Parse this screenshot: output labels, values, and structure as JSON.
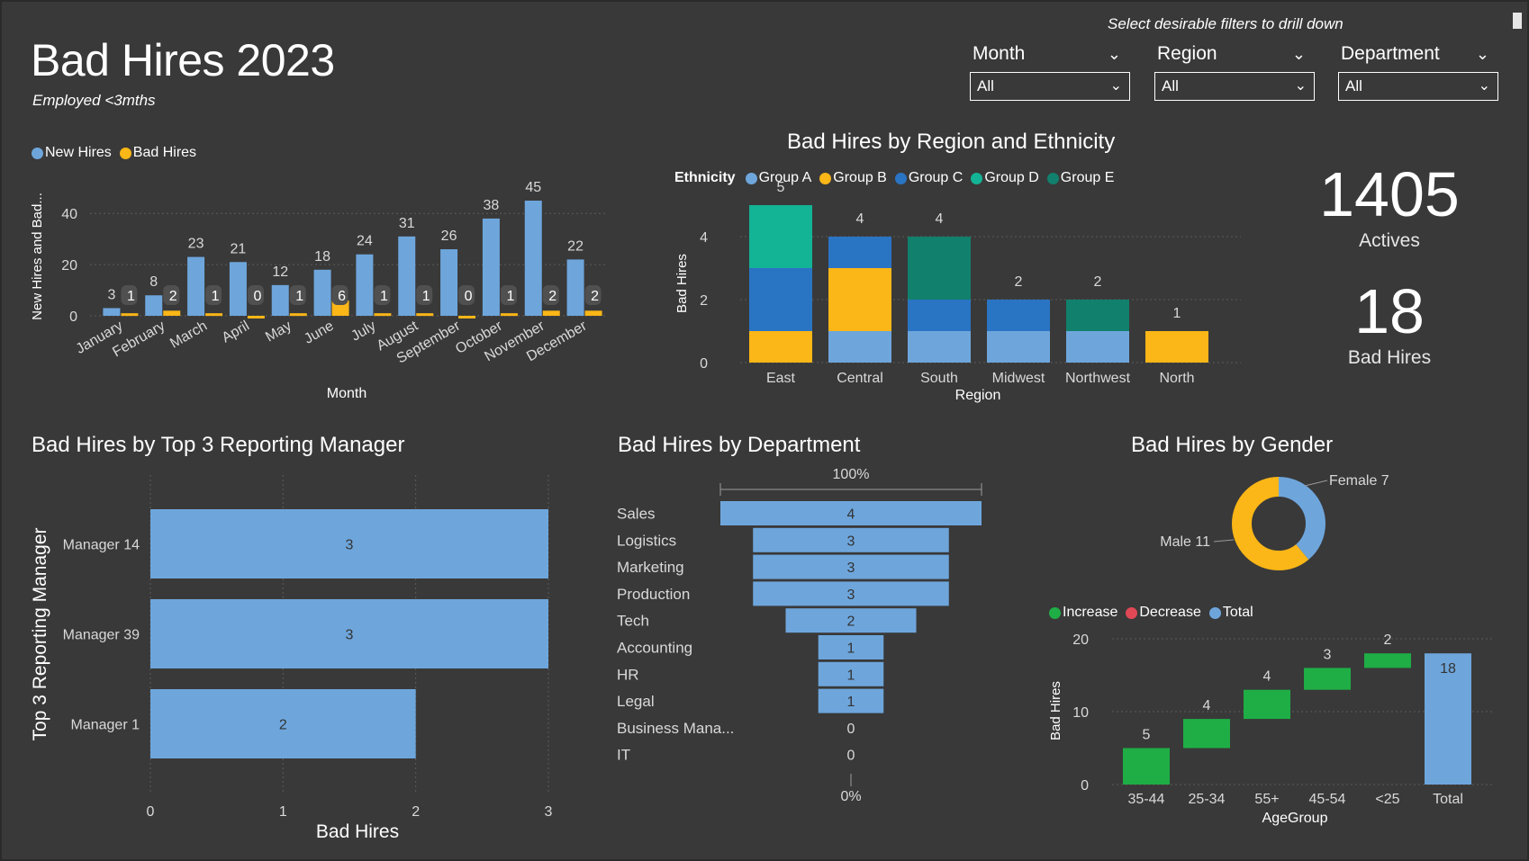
{
  "header": {
    "title": "Bad Hires 2023",
    "subtitle": "Employed <3mths",
    "filter_hint": "Select desirable filters to drill down"
  },
  "filters": [
    {
      "label": "Month",
      "value": "All"
    },
    {
      "label": "Region",
      "value": "All"
    },
    {
      "label": "Department",
      "value": "All"
    }
  ],
  "kpis": {
    "actives_value": "1405",
    "actives_label": "Actives",
    "bad_hires_value": "18",
    "bad_hires_label": "Bad Hires"
  },
  "colors": {
    "new_hires": "#6ea6dc",
    "bad_hires": "#fbb617",
    "group_a": "#6ea6dc",
    "group_b": "#fbb617",
    "group_c": "#2a74c4",
    "group_d": "#13b396",
    "group_e": "#11806c",
    "increase": "#1fae45",
    "decrease": "#e04856",
    "total": "#6ea6dc"
  },
  "chart_data": [
    {
      "id": "monthly",
      "type": "bar",
      "title": "",
      "xlabel": "Month",
      "ylabel": "New Hires and Bad...",
      "legend": "top-left",
      "categories": [
        "January",
        "February",
        "March",
        "April",
        "May",
        "June",
        "July",
        "August",
        "September",
        "October",
        "November",
        "December"
      ],
      "series": [
        {
          "name": "New Hires",
          "values": [
            3,
            8,
            23,
            21,
            12,
            18,
            24,
            31,
            26,
            38,
            45,
            22
          ]
        },
        {
          "name": "Bad Hires",
          "values": [
            1,
            2,
            1,
            0,
            1,
            6,
            1,
            1,
            0,
            1,
            2,
            2
          ]
        }
      ],
      "ylim": [
        0,
        45
      ],
      "yticks": [
        0,
        20,
        40
      ],
      "grid": true
    },
    {
      "id": "region",
      "type": "bar",
      "stacked": true,
      "title": "Bad Hires by Region and Ethnicity",
      "xlabel": "Region",
      "ylabel": "Bad Hires",
      "legend_title": "Ethnicity",
      "categories": [
        "East",
        "Central",
        "South",
        "Midwest",
        "Northwest",
        "North"
      ],
      "totals": [
        5,
        4,
        4,
        2,
        2,
        1
      ],
      "series": [
        {
          "name": "Group A",
          "values": [
            0,
            1,
            1,
            1,
            1,
            0
          ]
        },
        {
          "name": "Group B",
          "values": [
            1,
            2,
            0,
            0,
            0,
            1
          ]
        },
        {
          "name": "Group C",
          "values": [
            2,
            1,
            1,
            1,
            0,
            0
          ]
        },
        {
          "name": "Group D",
          "values": [
            2,
            0,
            0,
            0,
            0,
            0
          ]
        },
        {
          "name": "Group E",
          "values": [
            0,
            0,
            2,
            0,
            1,
            0
          ]
        }
      ],
      "ylim": [
        0,
        5
      ],
      "yticks": [
        0,
        2,
        4
      ],
      "grid": true
    },
    {
      "id": "manager",
      "type": "bar",
      "orientation": "horizontal",
      "title": "Bad Hires by Top 3 Reporting Manager",
      "xlabel": "Bad Hires",
      "ylabel": "Top 3 Reporting Manager",
      "categories": [
        "Manager 14",
        "Manager 39",
        "Manager 1"
      ],
      "values": [
        3,
        3,
        2
      ],
      "xlim": [
        0,
        3
      ],
      "xticks": [
        0,
        1,
        2,
        3
      ],
      "grid": true
    },
    {
      "id": "department",
      "type": "bar",
      "subtype": "funnel",
      "title": "Bad Hires by Department",
      "top_label": "100%",
      "bottom_label": "0%",
      "categories": [
        "Sales",
        "Logistics",
        "Marketing",
        "Production",
        "Tech",
        "Accounting",
        "HR",
        "Legal",
        "Business Mana...",
        "IT"
      ],
      "values": [
        4,
        3,
        3,
        3,
        2,
        1,
        1,
        1,
        0,
        0
      ]
    },
    {
      "id": "gender",
      "type": "pie",
      "subtype": "donut",
      "title": "Bad Hires by Gender",
      "labels": [
        "Female",
        "Male"
      ],
      "values": [
        7,
        11
      ],
      "colors": [
        "#6ea6dc",
        "#fbb617"
      ]
    },
    {
      "id": "agegroup",
      "type": "bar",
      "subtype": "waterfall",
      "title": "",
      "xlabel": "AgeGroup",
      "ylabel": "Bad Hires",
      "legend": [
        "Increase",
        "Decrease",
        "Total"
      ],
      "categories": [
        "35-44",
        "25-34",
        "55+",
        "45-54",
        "<25",
        "Total"
      ],
      "values": [
        5,
        4,
        4,
        3,
        2,
        18
      ],
      "ylim": [
        0,
        20
      ],
      "yticks": [
        0,
        10,
        20
      ],
      "grid": true
    }
  ]
}
